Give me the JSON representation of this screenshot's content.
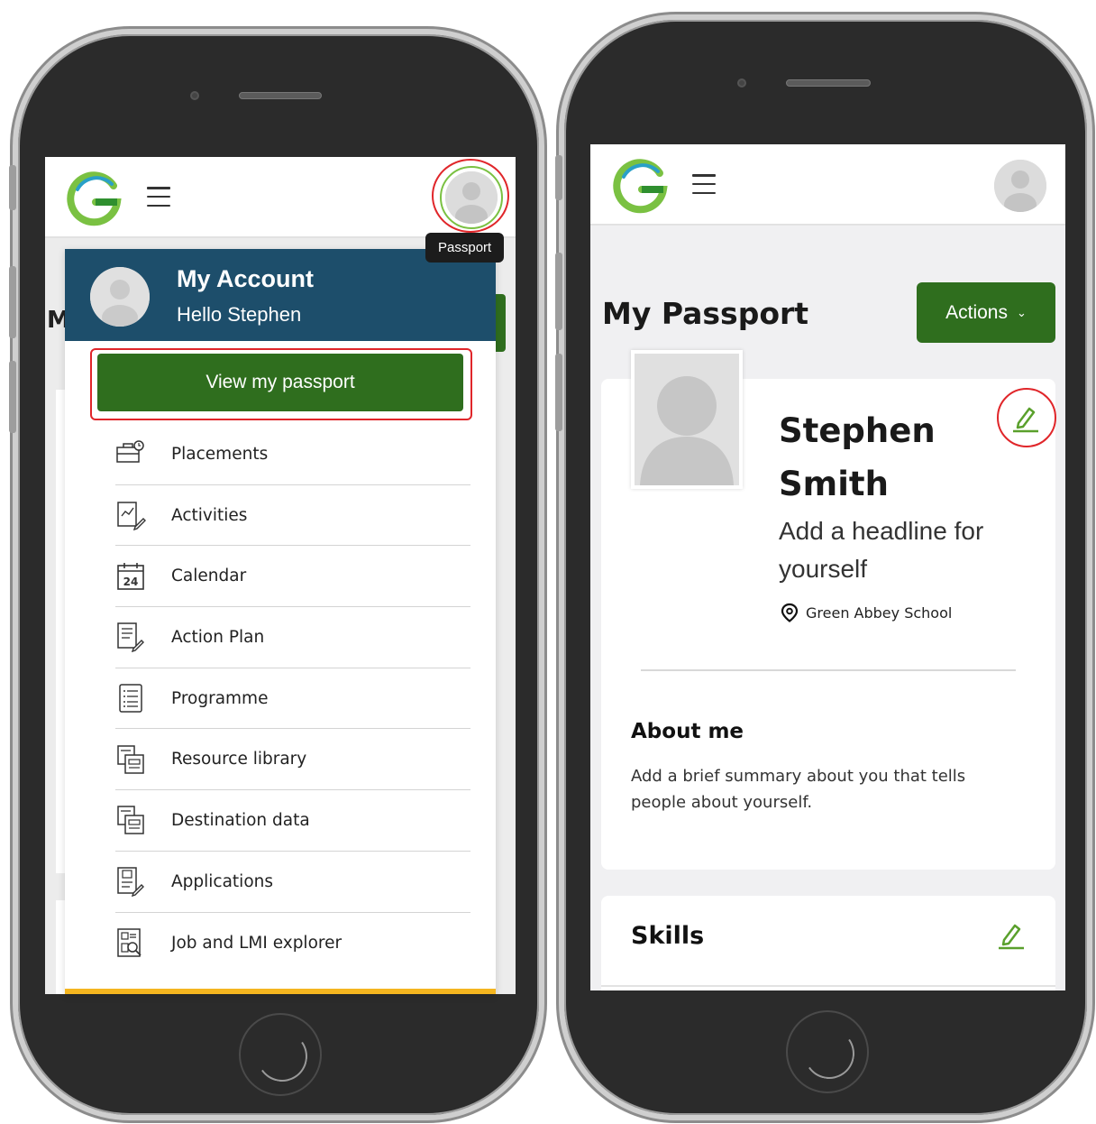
{
  "left_screen": {
    "tooltip": "Passport",
    "account": {
      "title": "My Account",
      "greeting": "Hello Stephen",
      "view_passport_label": "View my passport"
    },
    "menu_items": [
      {
        "label": "Placements",
        "icon": "briefcase-clock-icon"
      },
      {
        "label": "Activities",
        "icon": "chart-pencil-icon"
      },
      {
        "label": "Calendar",
        "icon": "calendar-icon",
        "icon_text": "24"
      },
      {
        "label": "Action Plan",
        "icon": "document-pencil-icon"
      },
      {
        "label": "Programme",
        "icon": "list-icon"
      },
      {
        "label": "Resource library",
        "icon": "files-icon"
      },
      {
        "label": "Destination data",
        "icon": "files-icon"
      },
      {
        "label": "Applications",
        "icon": "application-pencil-icon"
      },
      {
        "label": "Job and LMI explorer",
        "icon": "search-document-icon"
      }
    ],
    "bg_peek_letter": "M"
  },
  "right_screen": {
    "page_title": "My Passport",
    "actions_label": "Actions",
    "profile": {
      "name": "Stephen Smith",
      "headline": "Add a headline for yourself",
      "school": "Green Abbey School"
    },
    "about": {
      "title": "About me",
      "text": "Add a brief summary about you that tells people about yourself."
    },
    "skills_title": "Skills"
  },
  "colors": {
    "brand_green": "#2f6e1e",
    "account_header": "#1d4e6b",
    "highlight_red": "#e0262a",
    "accent_yellow": "#f4b51f"
  }
}
